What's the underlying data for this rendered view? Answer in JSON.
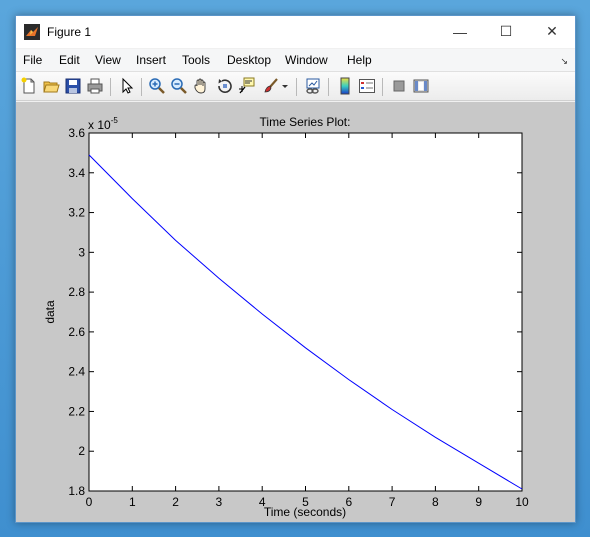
{
  "window": {
    "title": "Figure 1",
    "controls": {
      "minimize": "—",
      "maximize": "☐",
      "close": "✕"
    }
  },
  "menu": {
    "items": [
      "File",
      "Edit",
      "View",
      "Insert",
      "Tools",
      "Desktop",
      "Window",
      "Help"
    ],
    "dock_arrow": "↘"
  },
  "toolbar": {
    "buttons": [
      {
        "icon": "new-figure-icon"
      },
      {
        "icon": "open-file-icon"
      },
      {
        "icon": "save-icon"
      },
      {
        "icon": "print-icon"
      },
      {
        "icon": "edit-plot-arrow-icon"
      },
      {
        "icon": "zoom-in-icon"
      },
      {
        "icon": "zoom-out-icon"
      },
      {
        "icon": "pan-hand-icon"
      },
      {
        "icon": "rotate-3d-icon"
      },
      {
        "icon": "data-cursor-icon"
      },
      {
        "icon": "brush-icon"
      },
      {
        "icon": "brush-dropdown-icon"
      },
      {
        "icon": "link-plot-icon"
      },
      {
        "icon": "colorbar-icon"
      },
      {
        "icon": "legend-icon"
      },
      {
        "icon": "hide-plot-tools-icon"
      },
      {
        "icon": "show-plot-tools-icon"
      }
    ]
  },
  "chart_data": {
    "type": "line",
    "title": "Time Series Plot:",
    "xlabel": "Time (seconds)",
    "ylabel": "data",
    "exponent_label": "x 10",
    "exponent_power": "-5",
    "xlim": [
      0,
      10
    ],
    "ylim": [
      1.8,
      3.6
    ],
    "xticks": [
      0,
      1,
      2,
      3,
      4,
      5,
      6,
      7,
      8,
      9,
      10
    ],
    "yticks": [
      "1.8",
      "2",
      "2.2",
      "2.4",
      "2.6",
      "2.8",
      "3",
      "3.2",
      "3.4",
      "3.6"
    ],
    "grid": false,
    "series": [
      {
        "color": "#0000ff",
        "x": [
          0,
          1,
          2,
          3,
          4,
          5,
          6,
          7,
          8,
          9,
          10
        ],
        "y": [
          3.49,
          3.27,
          3.06,
          2.87,
          2.69,
          2.52,
          2.36,
          2.21,
          2.07,
          1.94,
          1.81
        ]
      }
    ]
  }
}
